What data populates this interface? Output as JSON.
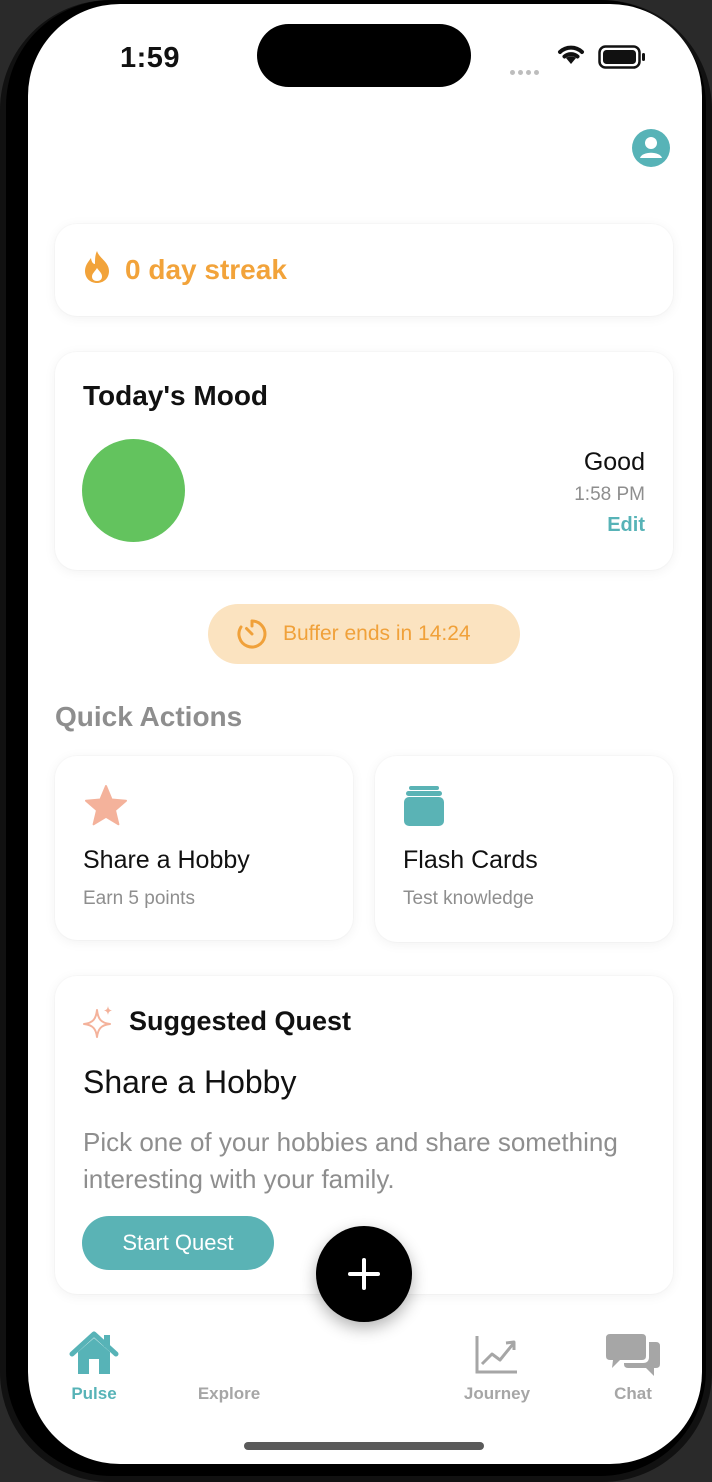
{
  "status_bar": {
    "time": "1:59"
  },
  "streak": {
    "text": "0 day streak",
    "color": "#f2a33a"
  },
  "mood": {
    "title": "Today's Mood",
    "value": "Good",
    "time": "1:58 PM",
    "edit_label": "Edit",
    "color": "#63c35e"
  },
  "buffer": {
    "text": "Buffer ends in 14:24"
  },
  "quick_actions": {
    "title": "Quick Actions",
    "items": [
      {
        "title": "Share a Hobby",
        "subtitle": "Earn 5 points",
        "icon": "star-icon"
      },
      {
        "title": "Flash Cards",
        "subtitle": "Test knowledge",
        "icon": "cards-icon"
      }
    ]
  },
  "quest": {
    "label": "Suggested Quest",
    "title": "Share a Hobby",
    "description": "Pick one of your hobbies and share something interesting with your family.",
    "button_label": "Start Quest"
  },
  "tabs": [
    {
      "label": "Pulse",
      "icon": "home-icon",
      "active": true
    },
    {
      "label": "Explore",
      "icon": "compass-icon",
      "active": false
    },
    {
      "label": "Journey",
      "icon": "chart-icon",
      "active": false
    },
    {
      "label": "Chat",
      "icon": "chat-icon",
      "active": false
    }
  ],
  "colors": {
    "accent": "#57b3b7",
    "streak": "#f2a33a",
    "mood": "#63c35e",
    "buffer_bg": "#fbe3c0"
  }
}
